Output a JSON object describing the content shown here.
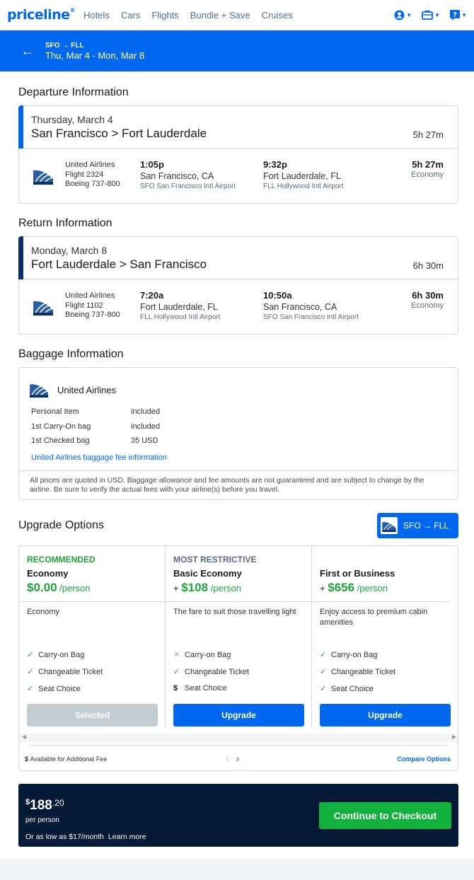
{
  "nav": {
    "logo": "priceline",
    "links": [
      "Hotels",
      "Cars",
      "Flights",
      "Bundle + Save",
      "Cruises"
    ]
  },
  "header": {
    "route": "SFO → FLL",
    "dates": "Thu, Mar 4 - Mon, Mar 8"
  },
  "departure": {
    "section_title": "Departure Information",
    "day": "Thursday, March 4",
    "route": "San Francisco > Fort Lauderdale",
    "duration": "5h 27m",
    "airline": "United Airlines",
    "flight": "Flight 2324",
    "aircraft": "Boeing 737-800",
    "dep_time": "1:05p",
    "dep_city": "San Francisco, CA",
    "dep_airport": "SFO San Francisco Intl Airport",
    "arr_time": "9:32p",
    "arr_city": "Fort Lauderdale, FL",
    "arr_airport": "FLL Hollywood Intl Airport",
    "total": "5h 27m",
    "cabin": "Economy",
    "accent": "#0068ef"
  },
  "return": {
    "section_title": "Return Information",
    "day": "Monday, March 8",
    "route": "Fort Lauderdale > San Francisco",
    "duration": "6h 30m",
    "airline": "United Airlines",
    "flight": "Flight 1102",
    "aircraft": "Boeing 737-800",
    "dep_time": "7:20a",
    "dep_city": "Fort Lauderdale, FL",
    "dep_airport": "FLL Hollywood Intl Airport",
    "arr_time": "10:50a",
    "arr_city": "San Francisco, CA",
    "arr_airport": "SFO San Francisco Intl Airport",
    "total": "6h 30m",
    "cabin": "Economy",
    "accent": "#0b2e6f"
  },
  "baggage": {
    "section_title": "Baggage Information",
    "airline": "United Airlines",
    "rows": [
      {
        "label": "Personal Item",
        "value": "included"
      },
      {
        "label": "1st Carry-On bag",
        "value": "included"
      },
      {
        "label": "1st Checked bag",
        "value": "35 USD"
      }
    ],
    "link": "United Airlines baggage fee information",
    "note": "All prices are quoted in USD. Baggage allowance and fee amounts are not guaranteed and are subject to change by the airline. Be sure to verify the actual fees with your airline(s) before you travel."
  },
  "upgrade": {
    "section_title": "Upgrade Options",
    "badge": "SFO → FLL",
    "options": [
      {
        "tag": "RECOMMENDED",
        "tag_color": "#1fa33a",
        "name": "Economy",
        "plus": "",
        "price": "$0.00",
        "per": " /person",
        "desc": "Economy",
        "features": [
          {
            "icon": "check",
            "label": "Carry-on Bag"
          },
          {
            "icon": "check",
            "label": "Changeable Ticket"
          },
          {
            "icon": "check",
            "label": "Seat Choice"
          }
        ],
        "button": "Selected",
        "selected": true
      },
      {
        "tag": "MOST RESTRICTIVE",
        "tag_color": "#5a6b7b",
        "name": "Basic Economy",
        "plus": "+ ",
        "price": "$108",
        "per": " /person",
        "desc": "The fare to suit those travelling light",
        "features": [
          {
            "icon": "x",
            "label": "Carry-on Bag"
          },
          {
            "icon": "check",
            "label": "Changeable Ticket"
          },
          {
            "icon": "dollar",
            "label": "Seat Choice"
          }
        ],
        "button": "Upgrade",
        "selected": false
      },
      {
        "tag": "",
        "tag_color": "#5a6b7b",
        "name": "First or Business",
        "plus": "+ ",
        "price": "$656",
        "per": " /person",
        "desc": "Enjoy access to premium cabin amenities",
        "features": [
          {
            "icon": "check",
            "label": "Carry-on Bag"
          },
          {
            "icon": "check",
            "label": "Changeable Ticket"
          },
          {
            "icon": "check",
            "label": "Seat Choice"
          }
        ],
        "button": "Upgrade",
        "selected": false
      }
    ],
    "available_note": "Available for Additional Fee",
    "compare": "Compare Options"
  },
  "checkout": {
    "dollar": "$",
    "price": "188",
    "cents": ".20",
    "per_person": "per person",
    "or_low": "Or as low as $17/month",
    "learn_more": "Learn more",
    "cta": "Continue to Checkout"
  }
}
